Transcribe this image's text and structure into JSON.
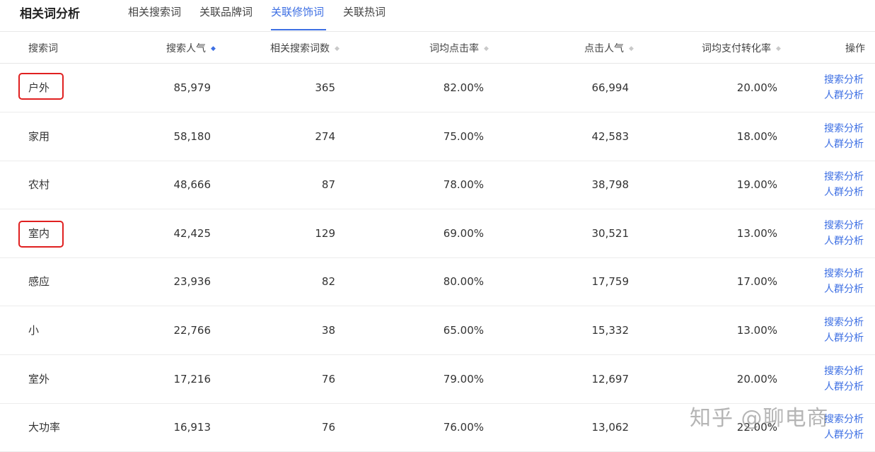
{
  "title": "相关词分析",
  "tabs": [
    {
      "label": "相关搜索词",
      "active": false
    },
    {
      "label": "关联品牌词",
      "active": false
    },
    {
      "label": "关联修饰词",
      "active": true
    },
    {
      "label": "关联热词",
      "active": false
    }
  ],
  "columns": {
    "keyword": "搜索词",
    "search_popularity": "搜索人气",
    "related_count": "相关搜索词数",
    "ctr": "词均点击率",
    "click_popularity": "点击人气",
    "conversion": "词均支付转化率",
    "action": "操作"
  },
  "sort_icon": "sort-icon",
  "rows": [
    {
      "keyword": "户外",
      "search_popularity": "85,979",
      "related_count": "365",
      "ctr": "82.00%",
      "click_popularity": "66,994",
      "conversion": "20.00%",
      "action1": "搜索分析",
      "action2": "人群分析"
    },
    {
      "keyword": "家用",
      "search_popularity": "58,180",
      "related_count": "274",
      "ctr": "75.00%",
      "click_popularity": "42,583",
      "conversion": "18.00%",
      "action1": "搜索分析",
      "action2": "人群分析"
    },
    {
      "keyword": "农村",
      "search_popularity": "48,666",
      "related_count": "87",
      "ctr": "78.00%",
      "click_popularity": "38,798",
      "conversion": "19.00%",
      "action1": "搜索分析",
      "action2": "人群分析"
    },
    {
      "keyword": "室内",
      "search_popularity": "42,425",
      "related_count": "129",
      "ctr": "69.00%",
      "click_popularity": "30,521",
      "conversion": "13.00%",
      "action1": "搜索分析",
      "action2": "人群分析"
    },
    {
      "keyword": "感应",
      "search_popularity": "23,936",
      "related_count": "82",
      "ctr": "80.00%",
      "click_popularity": "17,759",
      "conversion": "17.00%",
      "action1": "搜索分析",
      "action2": "人群分析"
    },
    {
      "keyword": "小",
      "search_popularity": "22,766",
      "related_count": "38",
      "ctr": "65.00%",
      "click_popularity": "15,332",
      "conversion": "13.00%",
      "action1": "搜索分析",
      "action2": "人群分析"
    },
    {
      "keyword": "室外",
      "search_popularity": "17,216",
      "related_count": "76",
      "ctr": "79.00%",
      "click_popularity": "12,697",
      "conversion": "20.00%",
      "action1": "搜索分析",
      "action2": "人群分析"
    },
    {
      "keyword": "大功率",
      "search_popularity": "16,913",
      "related_count": "76",
      "ctr": "76.00%",
      "click_popularity": "13,062",
      "conversion": "22.00%",
      "action1": "搜索分析",
      "action2": "人群分析"
    }
  ],
  "watermark": "知乎 @聊电商",
  "colors": {
    "accent": "#3d6fe3",
    "highlight": "#e02020"
  }
}
